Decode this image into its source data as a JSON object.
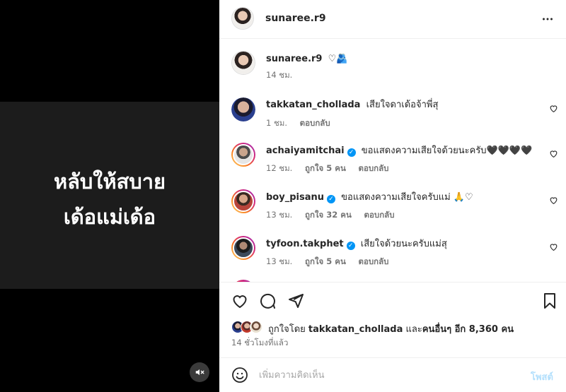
{
  "media": {
    "text_line1": "หลับให้สบาย",
    "text_line2": "เด้อแม่เด้อ",
    "mute_icon": "speaker-muted-icon"
  },
  "header": {
    "username": "sunaree.r9",
    "more_icon": "more-horizontal-icon"
  },
  "caption": {
    "username": "sunaree.r9",
    "text": "♡🫂",
    "time": "14 ชม."
  },
  "comments": [
    {
      "username": "takkatan_chollada",
      "verified": false,
      "text": "เสียใจดาเด้อจ้าพี่สุ",
      "time": "1 ชม.",
      "likes": "",
      "reply": "ตอบกลับ"
    },
    {
      "username": "achaiyamitchai",
      "verified": true,
      "text": "ขอแสดงความเสียใจด้วยนะครับ🖤🖤🖤🖤",
      "time": "12 ชม.",
      "likes": "ถูกใจ 5 คน",
      "reply": "ตอบกลับ"
    },
    {
      "username": "boy_pisanu",
      "verified": true,
      "text": "ขอแสดงความเสียใจครับแม่ 🙏♡",
      "time": "13 ชม.",
      "likes": "ถูกใจ 32 คน",
      "reply": "ตอบกลับ"
    },
    {
      "username": "tyfoon.takphet",
      "verified": true,
      "text": "เสียใจด้วยนะครับแม่สุ",
      "time": "13 ชม.",
      "likes": "ถูกใจ 5 คน",
      "reply": "ตอบกลับ"
    }
  ],
  "actions": {
    "like_icon": "heart-icon",
    "comment_icon": "comment-icon",
    "share_icon": "share-icon",
    "save_icon": "bookmark-icon"
  },
  "likes": {
    "prefix": "ถูกใจโดย",
    "user": "takkatan_chollada",
    "middle": "และ",
    "others": "คนอื่นๆ อีก 8,360 คน"
  },
  "timestamp": "14 ชั่วโมงที่แล้ว",
  "add_comment": {
    "placeholder": "เพิ่มความคิดเห็น",
    "post_label": "โพสต์",
    "emoji_icon": "emoji-icon"
  },
  "colors": {
    "accent": "#0095f6",
    "post_disabled": "#b2dffc",
    "muted_text": "#737373"
  }
}
